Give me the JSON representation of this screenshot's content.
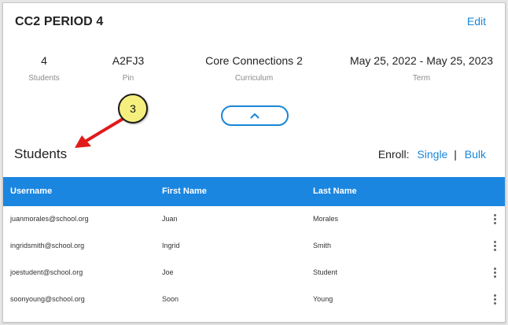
{
  "header": {
    "title": "CC2 PERIOD 4",
    "edit_label": "Edit"
  },
  "stats": [
    {
      "value": "4",
      "label": "Students"
    },
    {
      "value": "A2FJ3",
      "label": "Pin"
    },
    {
      "value": "Core Connections 2",
      "label": "Curriculum"
    },
    {
      "value": "May 25, 2022  -  May 25, 2023",
      "label": "Term"
    }
  ],
  "collapse_icon": "chevron-up-icon",
  "students_section": {
    "heading": "Students",
    "enroll_label": "Enroll:",
    "single_label": "Single",
    "separator": "|",
    "bulk_label": "Bulk"
  },
  "table": {
    "columns": [
      "Username",
      "First Name",
      "Last Name"
    ],
    "rows": [
      {
        "username": "juanmorales@school.org",
        "first": "Juan",
        "last": "Morales"
      },
      {
        "username": "ingridsmith@school.org",
        "first": "Ingrid",
        "last": "Smith"
      },
      {
        "username": "joestudent@school.org",
        "first": "Joe",
        "last": "Student"
      },
      {
        "username": "soonyoung@school.org",
        "first": "Soon",
        "last": "Young"
      }
    ]
  },
  "annotation": {
    "number": "3",
    "callout_color": "#f5f07e",
    "arrow_color": "#e01b1b"
  },
  "colors": {
    "accent": "#1a86d8",
    "header_bar": "#1b86e0"
  }
}
